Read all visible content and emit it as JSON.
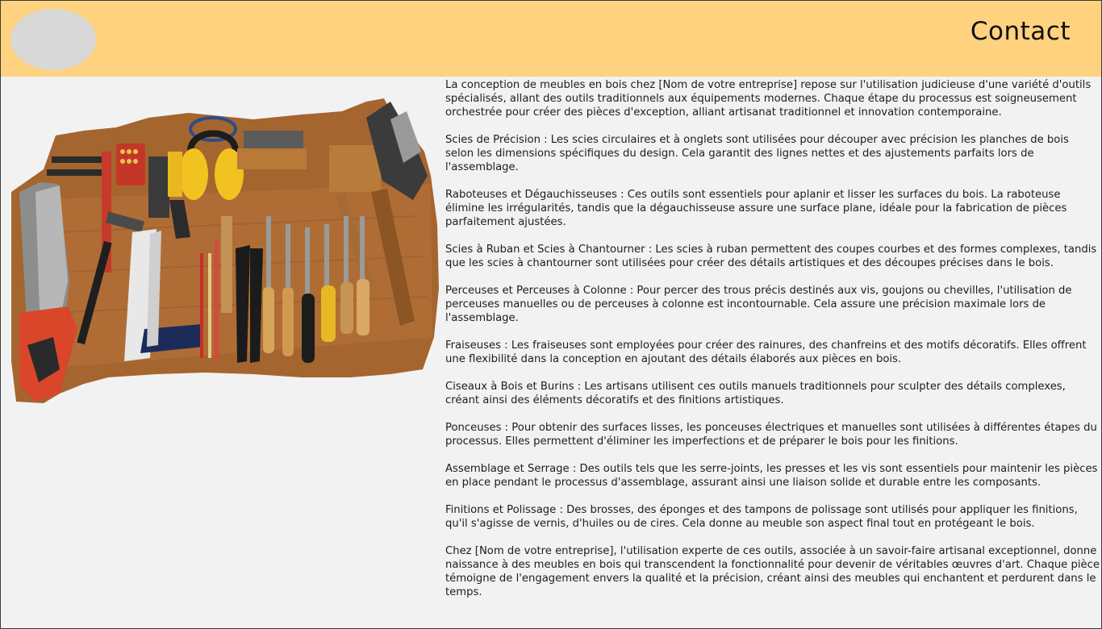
{
  "header": {
    "contact_label": "Contact",
    "logo_icon": "logo-placeholder"
  },
  "image": {
    "alt": "Outils de menuiserie",
    "icon": "woodworking-tools-photo"
  },
  "article": {
    "paragraphs": [
      "La conception de meubles en bois chez [Nom de votre entreprise] repose sur l'utilisation judicieuse d'une variété d'outils spécialisés, allant des outils traditionnels aux équipements modernes. Chaque étape du processus est soigneusement orchestrée pour créer des pièces d'exception, alliant artisanat traditionnel et innovation contemporaine.",
      "Scies de Précision : Les scies circulaires et à onglets sont utilisées pour découper avec précision les planches de bois selon les dimensions spécifiques du design. Cela garantit des lignes nettes et des ajustements parfaits lors de l'assemblage.",
      "Raboteuses et Dégauchisseuses : Ces outils sont essentiels pour aplanir et lisser les surfaces du bois. La raboteuse élimine les irrégularités, tandis que la dégauchisseuse assure une surface plane, idéale pour la fabrication de pièces parfaitement ajustées.",
      "Scies à Ruban et Scies à Chantourner : Les scies à ruban permettent des coupes courbes et des formes complexes, tandis que les scies à chantourner sont utilisées pour créer des détails artistiques et des découpes précises dans le bois.",
      "Perceuses et Perceuses à Colonne : Pour percer des trous précis destinés aux vis, goujons ou chevilles, l'utilisation de perceuses manuelles ou de perceuses à colonne est incontournable. Cela assure une précision maximale lors de l'assemblage.",
      "Fraiseuses : Les fraiseuses sont employées pour créer des rainures, des chanfreins et des motifs décoratifs. Elles offrent une flexibilité dans la conception en ajoutant des détails élaborés aux pièces en bois.",
      "Ciseaux à Bois et Burins : Les artisans utilisent ces outils manuels traditionnels pour sculpter des détails complexes, créant ainsi des éléments décoratifs et des finitions artistiques.",
      "Ponceuses : Pour obtenir des surfaces lisses, les ponceuses électriques et manuelles sont utilisées à différentes étapes du processus. Elles permettent d'éliminer les imperfections et de préparer le bois pour les finitions.",
      "Assemblage et Serrage : Des outils tels que les serre-joints, les presses et les vis sont essentiels pour maintenir les pièces en place pendant le processus d'assemblage, assurant ainsi une liaison solide et durable entre les composants.",
      "Finitions et Polissage : Des brosses, des éponges et des tampons de polissage sont utilisés pour appliquer les finitions, qu'il s'agisse de vernis, d'huiles ou de cires. Cela donne au meuble son aspect final tout en protégeant le bois.",
      "Chez [Nom de votre entreprise], l'utilisation experte de ces outils, associée à un savoir-faire artisanal exceptionnel, donne naissance à des meubles en bois qui transcendent la fonctionnalité pour devenir de véritables œuvres d'art. Chaque pièce témoigne de l'engagement envers la qualité et la précision, créant ainsi des meubles qui enchantent et perdurent dans le temps."
    ]
  },
  "colors": {
    "header_bg": "#ffd27f",
    "page_bg": "#f2f2f2",
    "logo_bg": "#d8d8d8"
  }
}
